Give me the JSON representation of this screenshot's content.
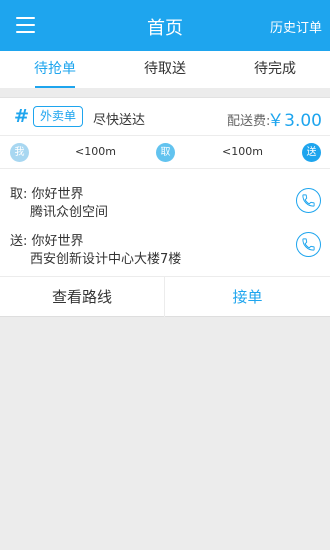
{
  "header": {
    "title": "首页",
    "history": "历史订单"
  },
  "tabs": [
    "待抢单",
    "待取送",
    "待完成"
  ],
  "order": {
    "hash": "#",
    "tag": "外卖单",
    "subtitle": "尽快送达",
    "fee_label": "配送费:",
    "fee_value": "￥3.00",
    "route": {
      "me": "我",
      "pickup": "取",
      "deliver": "送",
      "distance_to_pickup": "<100m",
      "distance_to_deliver": "<100m"
    },
    "pickup": {
      "label": "取:",
      "name": "你好世界",
      "address": "腾讯众创空间"
    },
    "delivery": {
      "label": "送:",
      "name": "你好世界",
      "address": "西安创新设计中心大楼7楼"
    },
    "actions": {
      "view_route": "查看路线",
      "accept": "接单"
    }
  },
  "colors": {
    "accent": "#1ea5ee",
    "background": "#ececec"
  }
}
